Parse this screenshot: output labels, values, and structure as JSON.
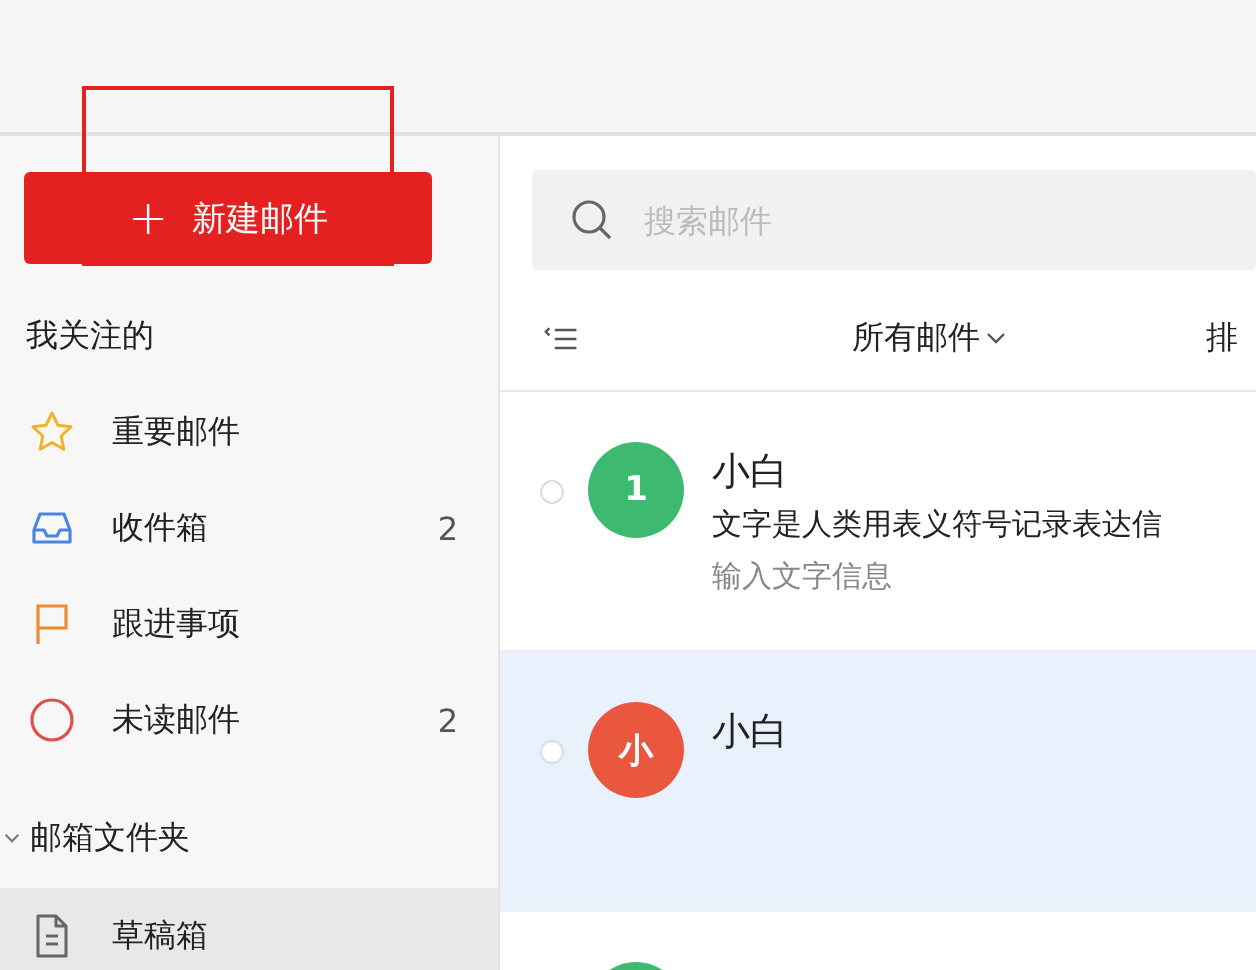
{
  "compose_button": {
    "icon": "+",
    "label": "新建邮件",
    "highlighted": true
  },
  "sidebar": {
    "section_title": "我关注的",
    "items": [
      {
        "kind": "star",
        "label": "重要邮件"
      },
      {
        "kind": "inbox",
        "label": "收件箱",
        "count": "2"
      },
      {
        "kind": "flag",
        "label": "跟进事项"
      },
      {
        "kind": "unread",
        "label": "未读邮件",
        "count": "2"
      }
    ],
    "folders": {
      "title": "邮箱文件夹",
      "expanded": true,
      "items": [
        {
          "kind": "draft",
          "label": "草稿箱",
          "selected": true
        }
      ]
    }
  },
  "search": {
    "placeholder": "搜索邮件"
  },
  "toolbar": {
    "filter": "所有邮件",
    "sort": "排"
  },
  "emails": [
    {
      "avatar": "1",
      "color": "#3dba6f",
      "sender": "小白",
      "subject": "文字是人类用表义符号记录表达信",
      "preview": "输入文字信息",
      "selected": false
    },
    {
      "avatar": "小",
      "color": "#e9573f",
      "sender": "小白",
      "selected": true
    },
    {
      "color": "#3dba6f",
      "selected": false
    }
  ]
}
